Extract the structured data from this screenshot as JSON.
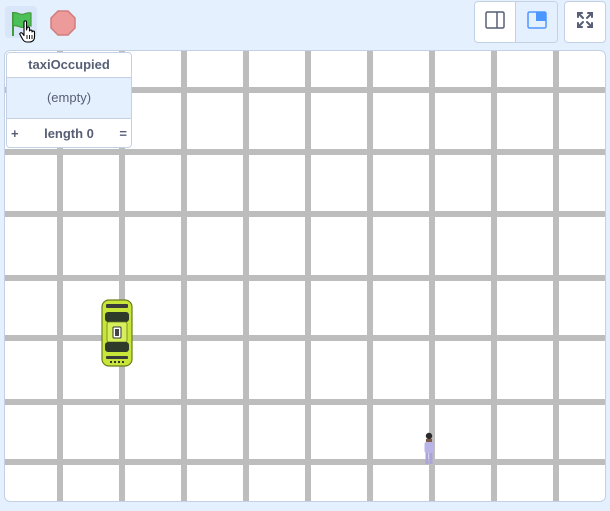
{
  "toolbar": {
    "green_flag": "green-flag-icon",
    "stop": "stop-icon",
    "small_stage": "small-stage-icon",
    "normal_stage": "normal-stage-icon",
    "fullscreen": "fullscreen-icon"
  },
  "monitor": {
    "title": "taxiOccupied",
    "empty_text": "(empty)",
    "add_label": "+",
    "length_label": "length 0",
    "resize_label": "="
  },
  "colors": {
    "accent": "#4c97ff",
    "stage_bg": "#e5f0ff",
    "road": "#bdbdbd",
    "taxi": "#c8e63a",
    "flag": "#4cbf56",
    "stop": "#ec5959"
  }
}
